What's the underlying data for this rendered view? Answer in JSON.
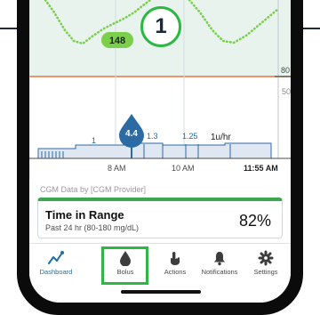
{
  "callout": {
    "step": "1"
  },
  "chart": {
    "glucose_badge": "148",
    "y_label_top": "80",
    "y_label_mid": "50",
    "bolus_value": "4.4",
    "basal_1": "1",
    "basal_2": "1.3",
    "basal_3": "1.25",
    "basal_rate": "1u/hr",
    "time_8am": "8 AM",
    "time_10am": "10 AM",
    "time_now": "11:55 AM"
  },
  "cgm_source": "CGM Data by [CGM Provider]",
  "time_in_range": {
    "title": "Time in Range",
    "subtitle": "Past 24 hr (80-180 mg/dL)",
    "value": "82%"
  },
  "tabs": [
    {
      "label": "Dashboard",
      "icon": "chart-line-icon"
    },
    {
      "label": "Bolus",
      "icon": "drop-icon"
    },
    {
      "label": "Actions",
      "icon": "hand-tap-icon"
    },
    {
      "label": "Notifications",
      "icon": "bell-icon"
    },
    {
      "label": "Settings",
      "icon": "gear-icon"
    }
  ],
  "colors": {
    "accent_green": "#2db843",
    "brand_blue": "#1f6ea8",
    "glucose_line": "#7bcf4a",
    "target_line": "#e9723a"
  }
}
